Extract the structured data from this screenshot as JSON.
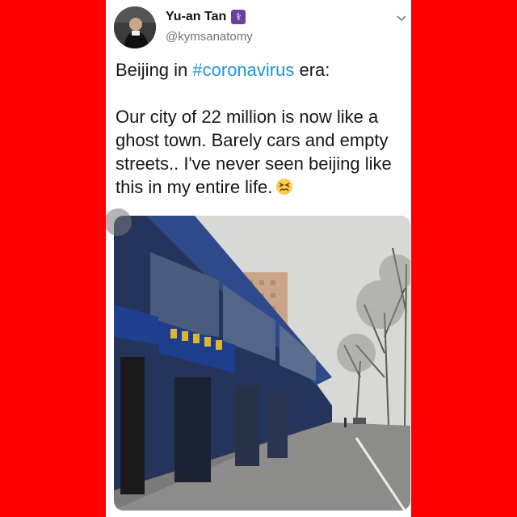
{
  "colors": {
    "background": "#ff0000",
    "card": "#ffffff",
    "hashtag": "#1b95e0",
    "text": "#14171a",
    "handle": "#6b7480"
  },
  "tweet": {
    "author_name": "Yu-an Tan",
    "badge_icon": "medical-staff-icon",
    "handle": "@kymsanatomy",
    "text_prefix": "Beijing in ",
    "hashtag": "#coronavirus",
    "text_suffix": " era:",
    "body": "Our city of 22 million is now like a ghost town. Barely cars and empty streets.. I've never seen beijing like this in my entire life.",
    "emoji_icon": "persevering-face-icon",
    "menu_icon": "chevron-down-icon"
  },
  "media": {
    "kind": "video",
    "scene": "Beijing street with empty sidewalk and shops",
    "play_icon": "play-icon"
  }
}
